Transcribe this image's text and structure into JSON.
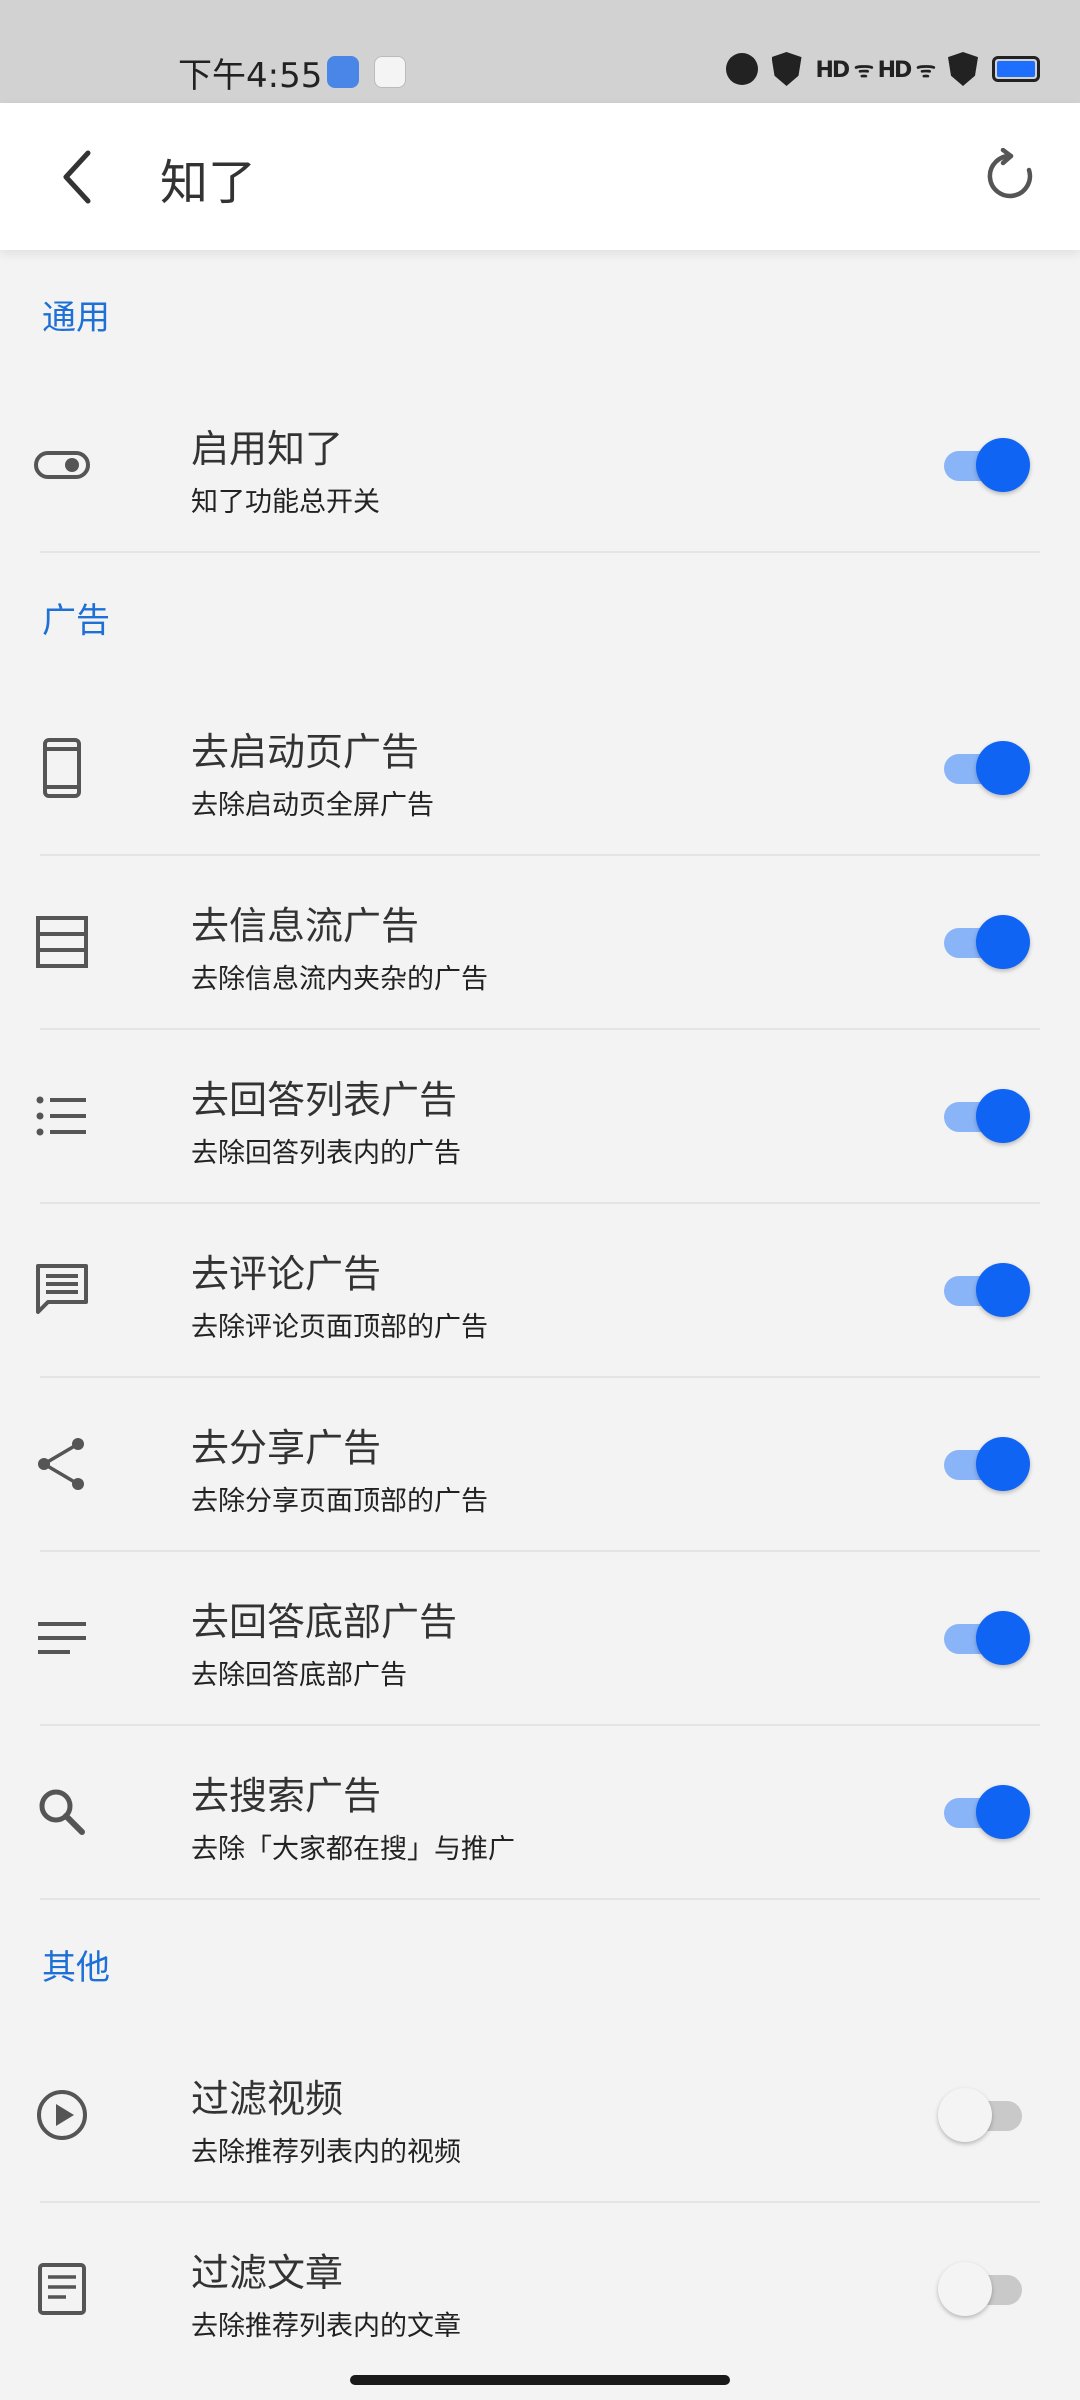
{
  "status_bar": {
    "time": "下午4:55",
    "signal_text": "HD ᯤ HD ᯤ",
    "battery_color": "#1f6fff"
  },
  "app_bar": {
    "title": "知了",
    "back_icon": "chevron-left-icon",
    "refresh_icon": "refresh-icon"
  },
  "accent_color": "#1e6fd6",
  "switch_on_color": "#1064f4",
  "sections": {
    "general": {
      "header": "通用",
      "items": [
        {
          "title": "启用知了",
          "summary": "知了功能总开关",
          "icon": "toggle-icon",
          "enabled": true
        }
      ]
    },
    "ads": {
      "header": "广告",
      "items": [
        {
          "title": "去启动页广告",
          "summary": "去除启动页全屏广告",
          "icon": "phone-icon",
          "enabled": true
        },
        {
          "title": "去信息流广告",
          "summary": "去除信息流内夹杂的广告",
          "icon": "feed-icon",
          "enabled": true
        },
        {
          "title": "去回答列表广告",
          "summary": "去除回答列表内的广告",
          "icon": "list-icon",
          "enabled": true
        },
        {
          "title": "去评论广告",
          "summary": "去除评论页面顶部的广告",
          "icon": "comment-icon",
          "enabled": true
        },
        {
          "title": "去分享广告",
          "summary": "去除分享页面顶部的广告",
          "icon": "share-icon",
          "enabled": true
        },
        {
          "title": "去回答底部广告",
          "summary": "去除回答底部广告",
          "icon": "lines-icon",
          "enabled": true
        },
        {
          "title": "去搜索广告",
          "summary": "去除「大家都在搜」与推广",
          "icon": "search-icon",
          "enabled": true
        }
      ]
    },
    "other": {
      "header": "其他",
      "items": [
        {
          "title": "过滤视频",
          "summary": "去除推荐列表内的视频",
          "icon": "play-circle-icon",
          "enabled": false
        },
        {
          "title": "过滤文章",
          "summary": "去除推荐列表内的文章",
          "icon": "article-icon",
          "enabled": false
        }
      ]
    }
  }
}
